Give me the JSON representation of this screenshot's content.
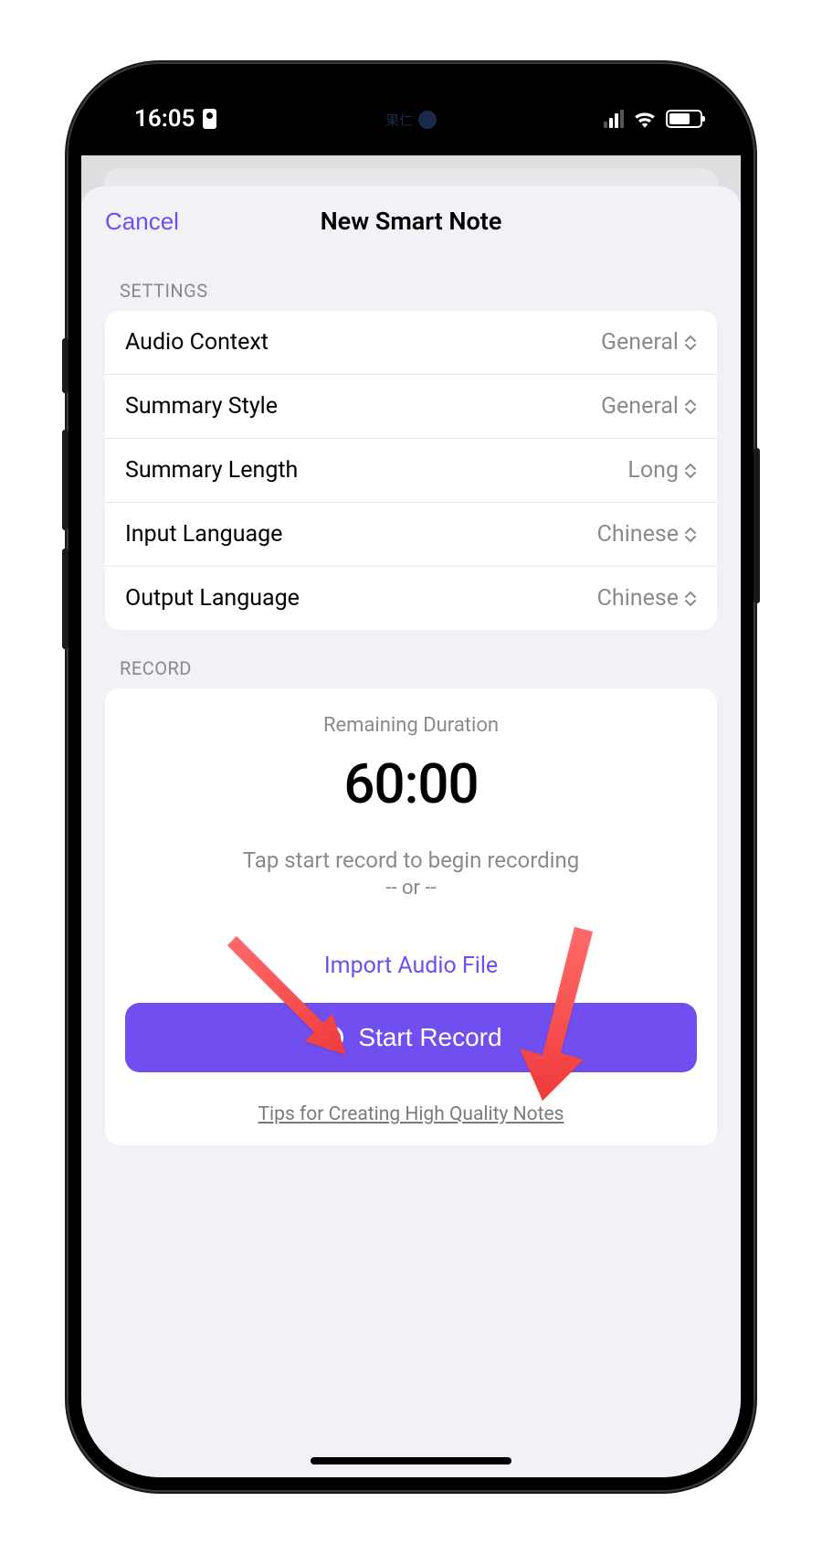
{
  "status": {
    "time": "16:05",
    "island_text": "果仁"
  },
  "sheet": {
    "cancel": "Cancel",
    "title": "New Smart Note"
  },
  "settings": {
    "header": "SETTINGS",
    "rows": {
      "audio_context": {
        "label": "Audio Context",
        "value": "General"
      },
      "summary_style": {
        "label": "Summary Style",
        "value": "General"
      },
      "summary_length": {
        "label": "Summary Length",
        "value": "Long"
      },
      "input_language": {
        "label": "Input Language",
        "value": "Chinese"
      },
      "output_language": {
        "label": "Output Language",
        "value": "Chinese"
      }
    }
  },
  "record": {
    "header": "RECORD",
    "remaining_label": "Remaining Duration",
    "timer": "60:00",
    "hint": "Tap start record to begin recording",
    "hint_or": "-- or --",
    "import": "Import Audio File",
    "start": "Start Record",
    "tips": "Tips for Creating High Quality Notes"
  }
}
